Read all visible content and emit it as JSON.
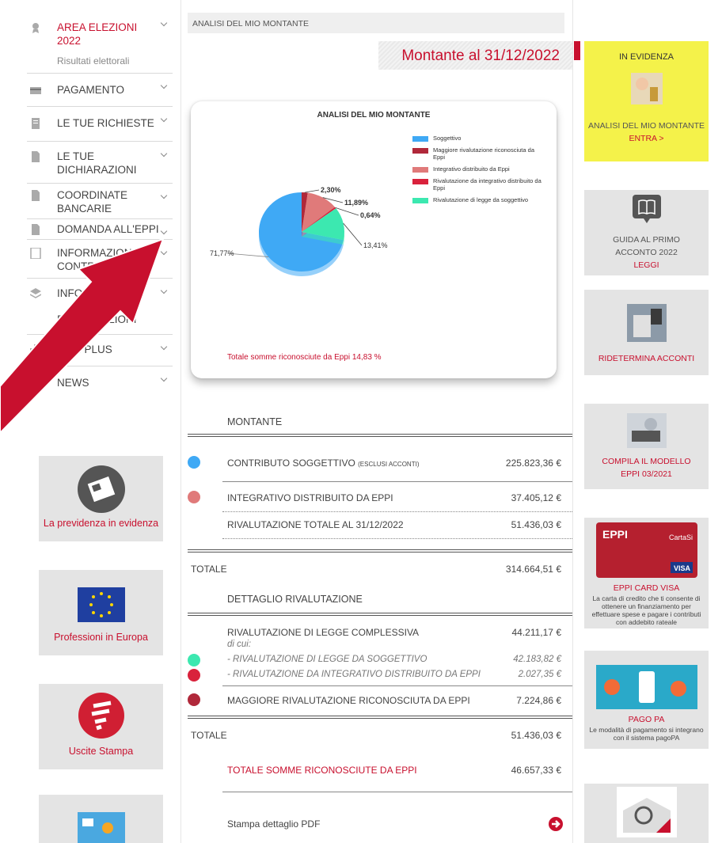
{
  "sidebar": {
    "items": [
      {
        "label": "AREA ELEZIONI 2022",
        "sub": "Risultati elettorali",
        "icon": "award-icon"
      },
      {
        "label": "PAGAMENTO",
        "icon": "card-icon"
      },
      {
        "label": "LE TUE RICHIESTE",
        "icon": "document-icon"
      },
      {
        "label": "LE TUE DICHIARAZIONI",
        "icon": "file-icon"
      },
      {
        "label": "COORDINATE BANCARIE",
        "icon": "file-icon"
      },
      {
        "label": "DOMANDA ALL'EPPI",
        "icon": "file-icon"
      },
      {
        "label": "INFORMAZIONI SUI CONTRIBUTI",
        "icon": "list-icon"
      },
      {
        "label": "INFORMAZIONI",
        "sub": "DICHIARAZIONI",
        "icon": "stack-icon"
      },
      {
        "label": "EPPI PLUS",
        "icon": "plus-icon"
      },
      {
        "label": "NEWS",
        "icon": "people-icon"
      }
    ],
    "boxes": [
      {
        "label": "La previdenza in evidenza"
      },
      {
        "label": "Professioni in Europa"
      },
      {
        "label": "Uscite Stampa"
      }
    ]
  },
  "main": {
    "breadcrumb": "ANALISI DEL MIO MONTANTE",
    "title": "Montante al 31/12/2022",
    "chart_footer": "Totale somme riconosciute da Eppi 14,83 %",
    "montante_label": "MONTANTE",
    "rows": [
      {
        "label": "CONTRIBUTO SOGGETTIVO",
        "suffix": "(ESCLUSI ACCONTI)",
        "value": "225.823,36 €"
      },
      {
        "label": "INTEGRATIVO DISTRIBUITO DA EPPI",
        "value": "37.405,12 €"
      },
      {
        "label": "RIVALUTAZIONE TOTALE AL 31/12/2022",
        "value": "51.436,03 €"
      }
    ],
    "totale1": {
      "label": "TOTALE",
      "value": "314.664,51 €"
    },
    "dettaglio_label": "DETTAGLIO RIVALUTAZIONE",
    "riv": {
      "label": "RIVALUTAZIONE DI LEGGE COMPLESSIVA",
      "value": "44.211,17 €",
      "dicui": "di cui:",
      "sub1": "- RIVALUTAZIONE DI LEGGE DA SOGGETTIVO",
      "sub1_value": "42.183,82 €",
      "sub2": "- RIVALUTAZIONE DA INTEGRATIVO DISTRIBUITO DA EPPI",
      "sub2_value": "2.027,35 €",
      "magg": "MAGGIORE RIVALUTAZIONE RICONOSCIUTA DA EPPI",
      "magg_value": "7.224,86 €"
    },
    "totale2": {
      "label": "TOTALE",
      "value": "51.436,03 €"
    },
    "somme": {
      "label": "TOTALE SOMME RICONOSCIUTE DA EPPI",
      "value": "46.657,33 €"
    },
    "stampa": "Stampa dettaglio PDF"
  },
  "right": {
    "evidenza": {
      "title": "IN EVIDENZA",
      "text": "ANALISI DEL MIO MONTANTE",
      "link": "ENTRA >"
    },
    "guida": {
      "t1": "GUIDA AL PRIMO",
      "t2": "ACCONTO 2022",
      "link": "LEGGI"
    },
    "ridetermina": {
      "link": "RIDETERMINA ACCONTI"
    },
    "compila": {
      "l1": "COMPILA IL MODELLO",
      "l2": "EPPI 03/2021"
    },
    "card": {
      "title": "EPPI CARD VISA",
      "desc": "La carta di credito che ti consente di ottenere un finanziamento per effettuare spese e pagare i contributi con addebito rateale"
    },
    "pagopa": {
      "title": "PAGO PA",
      "desc": "Le modalità di pagamento si integrano con il sistema pagoPA"
    }
  },
  "chart_data": {
    "type": "pie",
    "title": "ANALISI DEL MIO MONTANTE",
    "categories": [
      "Soggettivo",
      "Maggiore rivalutazione riconosciuta da Eppi",
      "Integrativo distribuito da Eppi",
      "Rivalutazione da integrativo distribuito da Eppi",
      "Rivalutazione di legge da soggettivo"
    ],
    "values": [
      71.77,
      2.3,
      11.89,
      0.64,
      13.41
    ],
    "labels": [
      "71,77%",
      "2,30%",
      "11,89%",
      "0,64%",
      "13,41%"
    ],
    "colors": [
      "#3fa9f5",
      "#b0283a",
      "#e07a7a",
      "#d9223c",
      "#3ce8b0"
    ],
    "legend": "right"
  }
}
